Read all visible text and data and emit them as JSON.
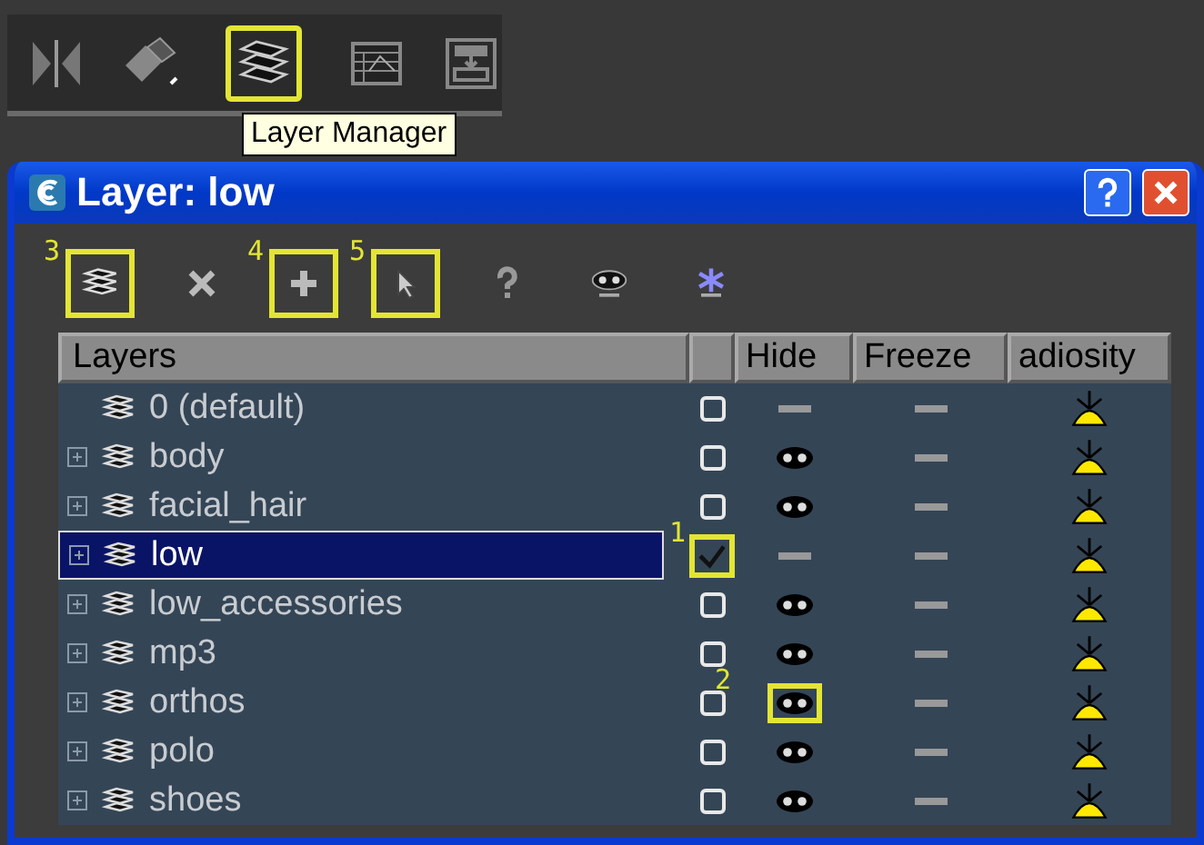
{
  "top_toolbar": {
    "buttons": [
      {
        "kind": "mirror",
        "highlighted": false
      },
      {
        "kind": "align",
        "highlighted": false
      },
      {
        "kind": "layers",
        "highlighted": true
      },
      {
        "kind": "curve-editor",
        "highlighted": false
      },
      {
        "kind": "schematic",
        "highlighted": false
      }
    ]
  },
  "tooltip": {
    "text": "Layer Manager"
  },
  "window": {
    "title": "Layer: low"
  },
  "toolbar": [
    {
      "kind": "new-layer",
      "callout": "3"
    },
    {
      "kind": "delete"
    },
    {
      "kind": "add",
      "callout": "4"
    },
    {
      "kind": "select",
      "callout": "5"
    },
    {
      "kind": "help"
    },
    {
      "kind": "hide-all"
    },
    {
      "kind": "freeze-all"
    }
  ],
  "columns": [
    "Layers",
    "Hide",
    "Freeze",
    "adiosity"
  ],
  "rows": [
    {
      "name": "0 (default)",
      "expandable": false,
      "selected": false,
      "current": false,
      "hidden": false,
      "frozen": false
    },
    {
      "name": "body",
      "expandable": true,
      "selected": false,
      "current": false,
      "hidden": true,
      "frozen": false
    },
    {
      "name": "facial_hair",
      "expandable": true,
      "selected": false,
      "current": false,
      "hidden": true,
      "frozen": false
    },
    {
      "name": "low",
      "expandable": true,
      "selected": true,
      "current": true,
      "hidden": false,
      "frozen": false,
      "current_callout": "1"
    },
    {
      "name": "low_accessories",
      "expandable": true,
      "selected": false,
      "current": false,
      "hidden": true,
      "frozen": false
    },
    {
      "name": "mp3",
      "expandable": true,
      "selected": false,
      "current": false,
      "hidden": true,
      "frozen": false
    },
    {
      "name": "orthos",
      "expandable": true,
      "selected": false,
      "current": false,
      "hidden": true,
      "frozen": false,
      "hide_callout": "2"
    },
    {
      "name": "polo",
      "expandable": true,
      "selected": false,
      "current": false,
      "hidden": true,
      "frozen": false
    },
    {
      "name": "shoes",
      "expandable": true,
      "selected": false,
      "current": false,
      "hidden": true,
      "frozen": false
    }
  ]
}
